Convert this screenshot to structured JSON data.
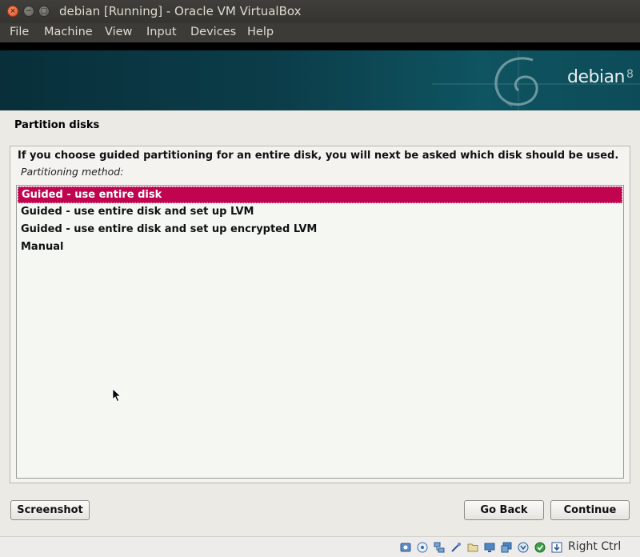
{
  "window": {
    "title": "debian [Running] - Oracle VM VirtualBox",
    "controls": {
      "close": "×",
      "minimize": "−",
      "maximize": "□"
    }
  },
  "menubar": {
    "items": [
      "File",
      "Machine",
      "View",
      "Input",
      "Devices",
      "Help"
    ]
  },
  "banner": {
    "brand": "debian",
    "version": "8"
  },
  "installer": {
    "title": "Partition disks",
    "description": "If you choose guided partitioning for an entire disk, you will next be asked which disk should be used.",
    "list_label": "Partitioning method:",
    "options": [
      "Guided - use entire disk",
      "Guided - use entire disk and set up LVM",
      "Guided - use entire disk and set up encrypted LVM",
      "Manual"
    ],
    "selected_index": 0,
    "buttons": {
      "screenshot": "Screenshot",
      "go_back": "Go Back",
      "continue": "Continue"
    }
  },
  "statusbar": {
    "icons": [
      "hard-disk-icon",
      "optical-drive-icon",
      "network-icon",
      "usb-icon",
      "shared-folder-icon",
      "display-icon",
      "video-capture-icon",
      "mouse-integration-icon",
      "keyboard-capture-icon",
      "download-icon"
    ],
    "host_key": "Right Ctrl"
  },
  "colors": {
    "selection": "#c0044f",
    "banner": "#0b3e4a",
    "installer_bg": "#eceae4"
  }
}
